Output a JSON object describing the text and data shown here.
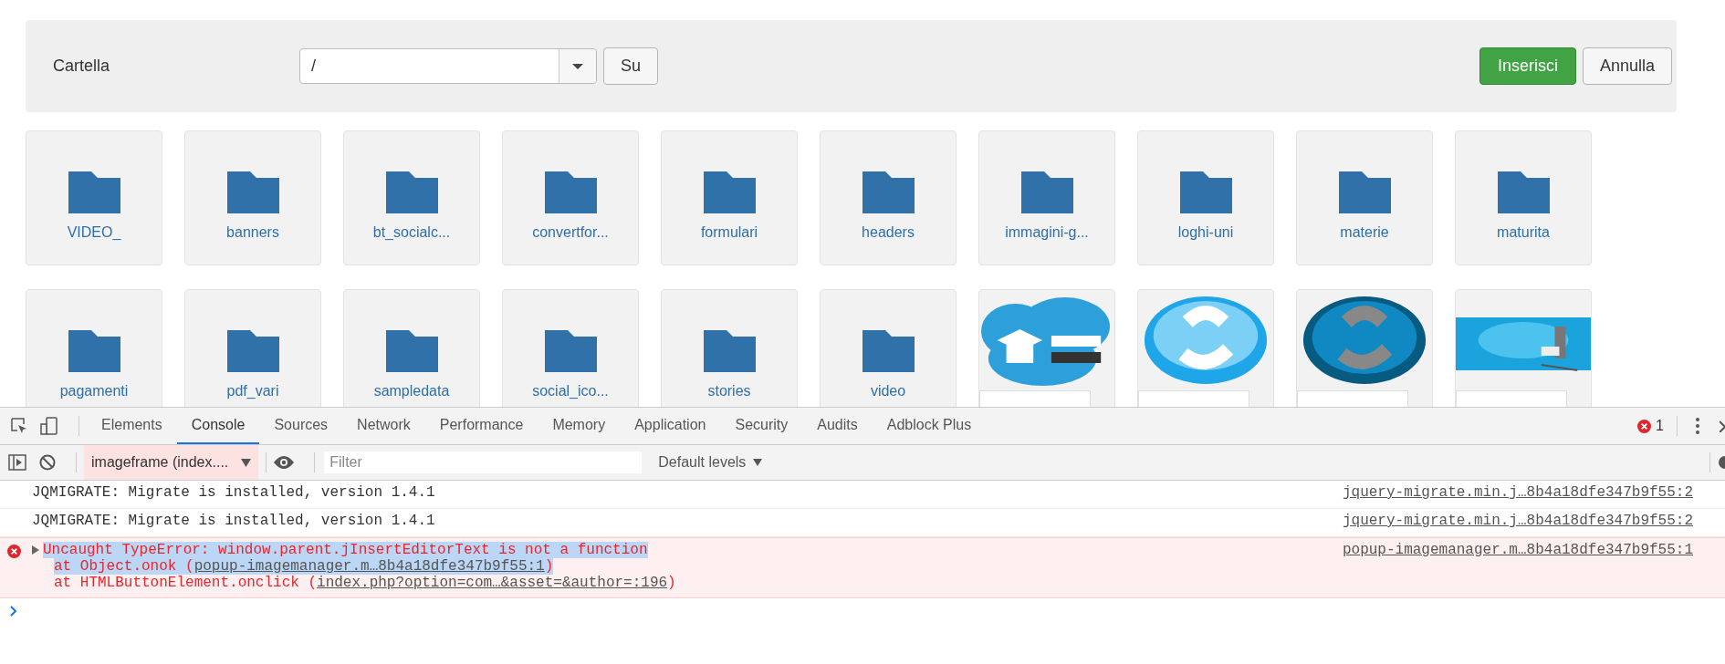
{
  "toolbar": {
    "folder_label": "Cartella",
    "path": {
      "value": "/"
    },
    "up_button": "Su",
    "insert_button": "Inserisci",
    "cancel_button": "Annulla"
  },
  "items": [
    {
      "kind": "folder",
      "label": "VIDEO_"
    },
    {
      "kind": "folder",
      "label": "banners"
    },
    {
      "kind": "folder",
      "label": "bt_socialc..."
    },
    {
      "kind": "folder",
      "label": "convertfor..."
    },
    {
      "kind": "folder",
      "label": "formulari"
    },
    {
      "kind": "folder",
      "label": "headers"
    },
    {
      "kind": "folder",
      "label": "immagini-g..."
    },
    {
      "kind": "folder",
      "label": "loghi-uni"
    },
    {
      "kind": "folder",
      "label": "materie"
    },
    {
      "kind": "folder",
      "label": "maturita"
    },
    {
      "kind": "folder",
      "label": "pagamenti"
    },
    {
      "kind": "folder",
      "label": "pdf_vari"
    },
    {
      "kind": "folder",
      "label": "sampledata"
    },
    {
      "kind": "folder",
      "label": "social_ico..."
    },
    {
      "kind": "folder",
      "label": "stories"
    },
    {
      "kind": "folder",
      "label": "video"
    },
    {
      "kind": "picture"
    },
    {
      "kind": "picture"
    },
    {
      "kind": "picture"
    },
    {
      "kind": "picture"
    }
  ],
  "devtools": {
    "tabs": [
      {
        "label": "Elements",
        "selected": false
      },
      {
        "label": "Console",
        "selected": true
      },
      {
        "label": "Sources",
        "selected": false
      },
      {
        "label": "Network",
        "selected": false
      },
      {
        "label": "Performance",
        "selected": false
      },
      {
        "label": "Memory",
        "selected": false
      },
      {
        "label": "Application",
        "selected": false
      },
      {
        "label": "Security",
        "selected": false
      },
      {
        "label": "Audits",
        "selected": false
      },
      {
        "label": "Adblock Plus",
        "selected": false
      }
    ],
    "error_count": "1",
    "context": "imageframe (index....",
    "filter": {
      "placeholder": "Filter"
    },
    "levels": "Default levels",
    "messages": [
      {
        "kind": "log",
        "text": "JQMIGRATE: Migrate is installed, version 1.4.1",
        "source": "jquery-migrate.min.j…8b4a18dfe347b9f55:2"
      },
      {
        "kind": "log",
        "text": "JQMIGRATE: Migrate is installed, version 1.4.1",
        "source": "jquery-migrate.min.j…8b4a18dfe347b9f55:2"
      },
      {
        "kind": "error",
        "text": "Uncaught TypeError: window.parent.jInsertEditorText is not a function",
        "selected": true,
        "source": "popup-imagemanager.m…8b4a18dfe347b9f55:1",
        "stack": [
          {
            "prefix": "at Object.onok (",
            "link": "popup-imagemanager.m…8b4a18dfe347b9f55:1",
            "suffix": ")",
            "selected": true
          },
          {
            "prefix": "at HTMLButtonElement.onclick (",
            "link": "index.php?option=com…&asset=&author=:196",
            "suffix": ")",
            "selected": false
          }
        ]
      }
    ]
  }
}
